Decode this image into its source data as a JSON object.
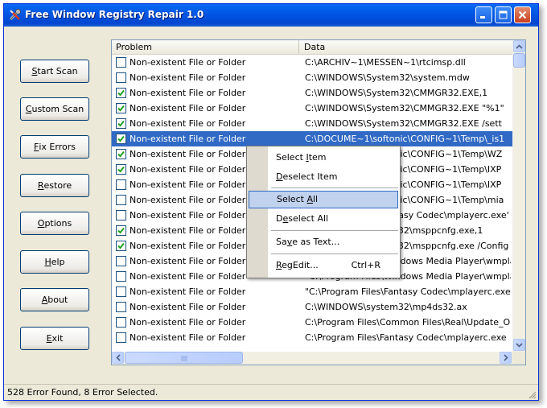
{
  "window": {
    "title": "Free Window Registry Repair 1.0"
  },
  "buttons": {
    "start_scan": {
      "pre": "",
      "key": "S",
      "post": "tart Scan"
    },
    "custom_scan": {
      "pre": "",
      "key": "C",
      "post": "ustom Scan"
    },
    "fix_errors": {
      "pre": "",
      "key": "F",
      "post": "ix Errors"
    },
    "restore": {
      "pre": "",
      "key": "R",
      "post": "estore"
    },
    "options": {
      "pre": "",
      "key": "O",
      "post": "ptions"
    },
    "help": {
      "pre": "",
      "key": "H",
      "post": "elp"
    },
    "about": {
      "pre": "",
      "key": "A",
      "post": "bout"
    },
    "exit": {
      "pre": "",
      "key": "E",
      "post": "xit"
    }
  },
  "list": {
    "columns": [
      "Problem",
      "Data"
    ],
    "rows": [
      {
        "checked": false,
        "problem": "Non-existent File or Folder",
        "data": "C:\\ARCHIV~1\\MESSEN~1\\rtcimsp.dll"
      },
      {
        "checked": false,
        "problem": "Non-existent File or Folder",
        "data": "C:\\WINDOWS\\System32\\system.mdw"
      },
      {
        "checked": true,
        "problem": "Non-existent File or Folder",
        "data": "C:\\WINDOWS\\System32\\CMMGR32.EXE,1"
      },
      {
        "checked": true,
        "problem": "Non-existent File or Folder",
        "data": "C:\\WINDOWS\\System32\\CMMGR32.EXE \"%1\""
      },
      {
        "checked": true,
        "problem": "Non-existent File or Folder",
        "data": "C:\\WINDOWS\\System32\\CMMGR32.EXE /sett"
      },
      {
        "checked": true,
        "problem": "Non-existent File or Folder",
        "data": "C:\\DOCUME~1\\softonic\\CONFIG~1\\Temp\\_is1"
      },
      {
        "checked": true,
        "problem": "Non-existent File or Folder",
        "data": "C:\\DOCUME~1\\softonic\\CONFIG~1\\Temp\\WZ"
      },
      {
        "checked": true,
        "problem": "Non-existent File or Folder",
        "data": "C:\\DOCUME~1\\softonic\\CONFIG~1\\Temp\\IXP"
      },
      {
        "checked": false,
        "problem": "Non-existent File or Folder",
        "data": "C:\\DOCUME~1\\softonic\\CONFIG~1\\Temp\\IXP"
      },
      {
        "checked": false,
        "problem": "Non-existent File or Folder",
        "data": "C:\\DOCUME~1\\softonic\\CONFIG~1\\Temp\\mia"
      },
      {
        "checked": false,
        "problem": "Non-existent File or Folder",
        "data": "C:\\Program Files\\Fantasy Codec\\mplayerc.exe'"
      },
      {
        "checked": true,
        "problem": "Non-existent File or Folder",
        "data": "C:\\WINDOWS\\system32\\msppcnfg.exe,1"
      },
      {
        "checked": true,
        "problem": "Non-existent File or Folder",
        "data": "C:\\WINDOWS\\system32\\msppcnfg.exe /Config"
      },
      {
        "checked": false,
        "problem": "Non-existent File or Folder",
        "data": "\"C:\\Program Files\\Windows Media Player\\wmplay"
      },
      {
        "checked": false,
        "problem": "Non-existent File or Folder",
        "data": "\"C:\\Program Files\\Windows Media Player\\wmpla"
      },
      {
        "checked": false,
        "problem": "Non-existent File or Folder",
        "data": "\"C:\\Program Files\\Fantasy Codec\\mplayerc.exe'"
      },
      {
        "checked": false,
        "problem": "Non-existent File or Folder",
        "data": "C:\\WINDOWS\\system32\\mp4ds32.ax"
      },
      {
        "checked": false,
        "problem": "Non-existent File or Folder",
        "data": "C:\\Program Files\\Common Files\\Real\\Update_O"
      },
      {
        "checked": false,
        "problem": "Non-existent File or Folder",
        "data": "C:\\Program Files\\Fantasy Codec\\mplayerc.exe"
      }
    ]
  },
  "context_menu": {
    "items": [
      {
        "pre": "Select ",
        "key": "I",
        "post": "tem",
        "shortcut": ""
      },
      {
        "pre": "",
        "key": "D",
        "post": "eselect Item",
        "shortcut": ""
      },
      {
        "pre": "Select ",
        "key": "A",
        "post": "ll",
        "shortcut": ""
      },
      {
        "pre": "D",
        "key": "e",
        "post": "select All",
        "shortcut": ""
      },
      {
        "pre": "Sa",
        "key": "v",
        "post": "e as Text...",
        "shortcut": ""
      },
      {
        "pre": "",
        "key": "R",
        "post": "egEdit...",
        "shortcut": "Ctrl+R"
      }
    ]
  },
  "status": {
    "text": "528 Error Found,  8 Error Selected."
  },
  "colors": {
    "selection": "#316ac5",
    "menu_hover": "#c1d2ee",
    "title_bar": "#0058e6"
  }
}
